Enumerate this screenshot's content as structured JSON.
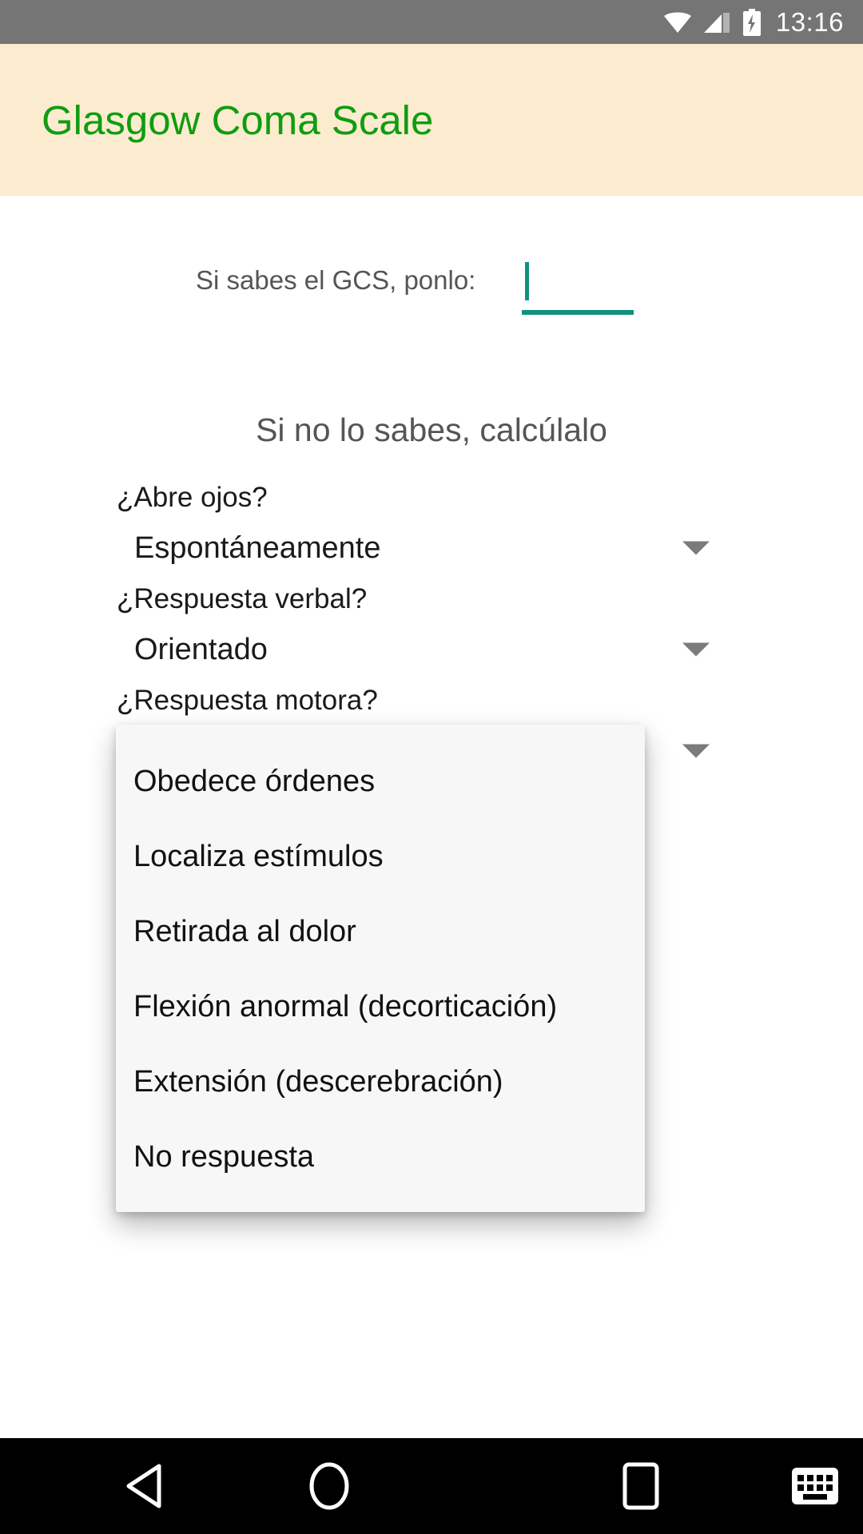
{
  "status_bar": {
    "time": "13:16",
    "icons": [
      "wifi-icon",
      "cellular-signal-icon",
      "battery-charging-icon"
    ]
  },
  "app_bar": {
    "title": "Glasgow Coma Scale",
    "background_color": "#fbecd0",
    "title_color": "#0f9d10"
  },
  "known_score": {
    "label": "Si sabes el GCS, ponlo:",
    "input_value": "",
    "input_placeholder": "",
    "accent_color": "#11917f"
  },
  "calculate": {
    "heading": "Si no lo sabes, calcúlalo"
  },
  "questions": [
    {
      "label": "¿Abre ojos?",
      "selected": "Espontáneamente"
    },
    {
      "label": "¿Respuesta verbal?",
      "selected": "Orientado"
    },
    {
      "label": "¿Respuesta motora?",
      "selected": ""
    }
  ],
  "dropdown": {
    "open_for": "¿Respuesta motora?",
    "options": [
      "Obedece órdenes",
      "Localiza estímulos",
      "Retirada al dolor",
      "Flexión anormal (decorticación)",
      "Extensión (descerebración)",
      "No respuesta"
    ]
  },
  "nav_bar": {
    "buttons": [
      "back-icon",
      "home-icon",
      "recents-icon",
      "keyboard-icon"
    ]
  }
}
